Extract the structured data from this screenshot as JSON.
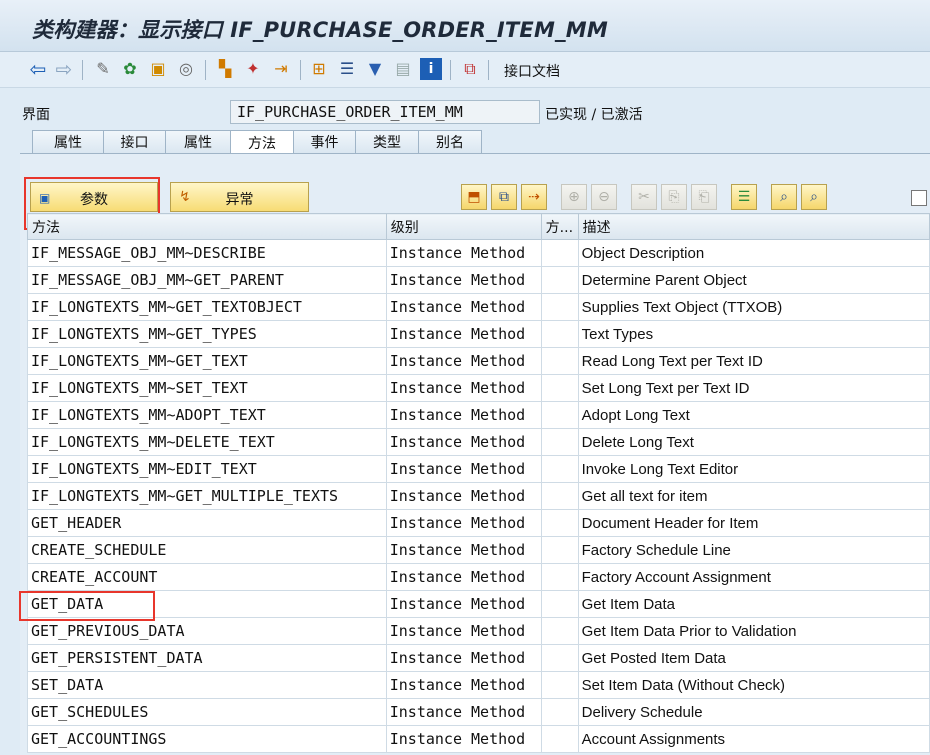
{
  "window": {
    "title": "类构建器：显示接口 IF_PURCHASE_ORDER_ITEM_MM"
  },
  "toolbar": {
    "icons": [
      "back-icon",
      "forward-icon",
      "switch-edit-icon",
      "object-icon",
      "activate-icon",
      "where-used-icon",
      "object-list-icon",
      "magic-wand-icon",
      "navigate-icon",
      "hierarchy-icon",
      "layout-icon",
      "filter-icon",
      "display-icon",
      "info-icon",
      "tree-icon"
    ],
    "docu_label": "接口文档"
  },
  "interface": {
    "label": "界面",
    "value": "IF_PURCHASE_ORDER_ITEM_MM",
    "status": "已实现 / 已激活"
  },
  "tabs": [
    {
      "label": "属性"
    },
    {
      "label": "接口"
    },
    {
      "label": "属性"
    },
    {
      "label": "方法"
    },
    {
      "label": "事件"
    },
    {
      "label": "类型"
    },
    {
      "label": "别名"
    }
  ],
  "buttons": {
    "params": "参数",
    "exceptions": "异常"
  },
  "columns": [
    "方法",
    "级别",
    "方...",
    "描述"
  ],
  "rows": [
    {
      "method": "IF_MESSAGE_OBJ_MM~DESCRIBE",
      "level": "Instance Method",
      "desc": "Object Description"
    },
    {
      "method": "IF_MESSAGE_OBJ_MM~GET_PARENT",
      "level": "Instance Method",
      "desc": "Determine Parent Object"
    },
    {
      "method": "IF_LONGTEXTS_MM~GET_TEXTOBJECT",
      "level": "Instance Method",
      "desc": "Supplies Text Object (TTXOB)"
    },
    {
      "method": "IF_LONGTEXTS_MM~GET_TYPES",
      "level": "Instance Method",
      "desc": "Text Types"
    },
    {
      "method": "IF_LONGTEXTS_MM~GET_TEXT",
      "level": "Instance Method",
      "desc": "Read Long Text per Text ID"
    },
    {
      "method": "IF_LONGTEXTS_MM~SET_TEXT",
      "level": "Instance Method",
      "desc": "Set Long Text per Text ID"
    },
    {
      "method": "IF_LONGTEXTS_MM~ADOPT_TEXT",
      "level": "Instance Method",
      "desc": "Adopt Long Text"
    },
    {
      "method": "IF_LONGTEXTS_MM~DELETE_TEXT",
      "level": "Instance Method",
      "desc": "Delete Long Text"
    },
    {
      "method": "IF_LONGTEXTS_MM~EDIT_TEXT",
      "level": "Instance Method",
      "desc": "Invoke Long Text Editor"
    },
    {
      "method": "IF_LONGTEXTS_MM~GET_MULTIPLE_TEXTS",
      "level": "Instance Method",
      "desc": "Get all text for item"
    },
    {
      "method": "GET_HEADER",
      "level": "Instance Method",
      "desc": "Document Header for Item"
    },
    {
      "method": "CREATE_SCHEDULE",
      "level": "Instance Method",
      "desc": "Factory Schedule Line"
    },
    {
      "method": "CREATE_ACCOUNT",
      "level": "Instance Method",
      "desc": "Factory Account Assignment"
    },
    {
      "method": "GET_DATA",
      "level": "Instance Method",
      "desc": "Get Item Data"
    },
    {
      "method": "GET_PREVIOUS_DATA",
      "level": "Instance Method",
      "desc": "Get Item Data Prior to Validation"
    },
    {
      "method": "GET_PERSISTENT_DATA",
      "level": "Instance Method",
      "desc": "Get Posted Item Data"
    },
    {
      "method": "SET_DATA",
      "level": "Instance Method",
      "desc": "Set Item Data (Without Check)"
    },
    {
      "method": "GET_SCHEDULES",
      "level": "Instance Method",
      "desc": "Delivery Schedule"
    },
    {
      "method": "GET_ACCOUNTINGS",
      "level": "Instance Method",
      "desc": "Account Assignments"
    }
  ]
}
